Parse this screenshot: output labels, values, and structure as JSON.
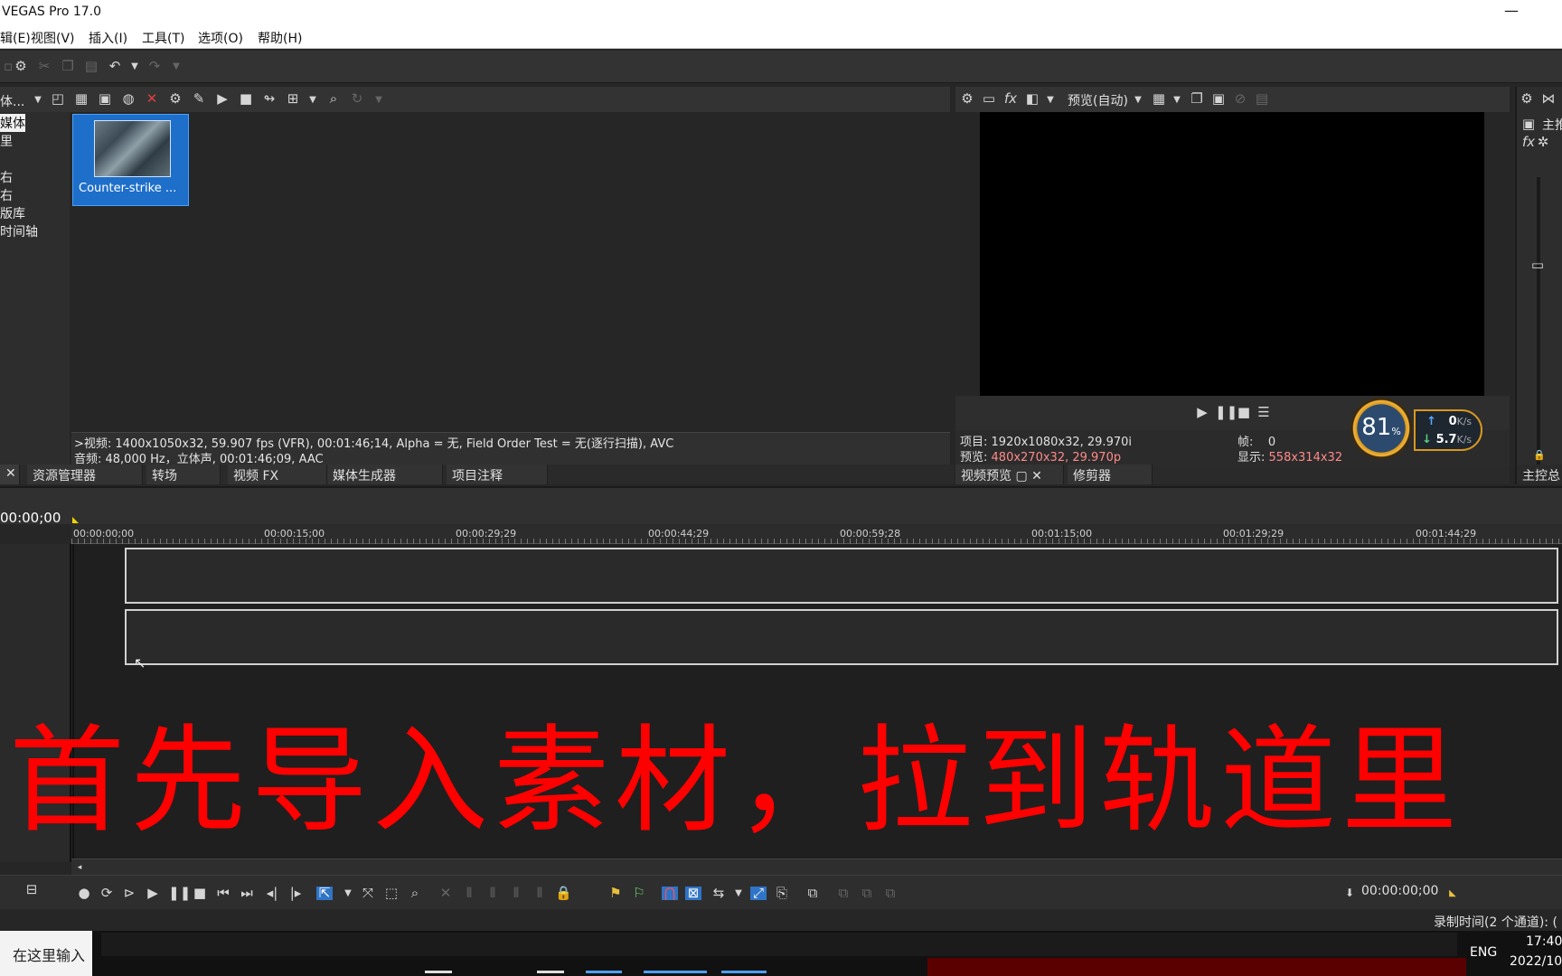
{
  "app": {
    "title": "VEGAS Pro 17.0",
    "minimize": "—",
    "close": "✕"
  },
  "menu": [
    {
      "label": "辑(E)"
    },
    {
      "label": "视图(V)"
    },
    {
      "label": "插入(I)"
    },
    {
      "label": "工具(T)"
    },
    {
      "label": "选项(O)"
    },
    {
      "label": "帮助(H)"
    }
  ],
  "explorer": {
    "dropdown": "体...",
    "tree": [
      "媒体",
      "里",
      "",
      "右",
      "右",
      "版库",
      "时间轴"
    ],
    "media_item": "Counter-strike ...",
    "info_video": ">视频: 1400x1050x32, 59.907 fps (VFR), 00:01:46;14, Alpha = 无, Field Order Test = 无(逐行扫描), AVC",
    "info_audio": "音频: 48,000 Hz，立体声, 00:01:46;09, AAC",
    "tabs": [
      "资源管理器",
      "转场",
      "视频 FX",
      "媒体生成器",
      "项目注释"
    ]
  },
  "preview": {
    "mode": "预览(自动)",
    "project_label": "项目:",
    "project_value": "1920x1080x32, 29.970i",
    "preview_label": "预览:",
    "preview_value": "480x270x32, 29.970p",
    "frame_label": "帧:",
    "frame_value": "0",
    "display_label": "显示:",
    "display_value": "558x314x32",
    "tabs": [
      "视频预览",
      "修剪器"
    ]
  },
  "meter": {
    "percent": "81",
    "percent_unit": "%",
    "up": "0",
    "down": "5.7",
    "unit": "K/s"
  },
  "mixer": {
    "label1": "主推",
    "tab": "主控总"
  },
  "timeline": {
    "current_time": "00:00;00",
    "ruler": [
      "00:00:00;00",
      "00:00:15;00",
      "00:00:29;29",
      "00:00:44;29",
      "00:00:59;28",
      "00:01:15;00",
      "00:01:29;29",
      "00:01:44;29"
    ],
    "transport_time": "00:00:00;00"
  },
  "overlay_caption": "首先导入素材，拉到轨道里",
  "status": {
    "record": "录制时间(2 个通道): ("
  },
  "taskbar": {
    "search": "在这里输入",
    "lang": "ENG",
    "time": "17:40",
    "date": "2022/10"
  }
}
